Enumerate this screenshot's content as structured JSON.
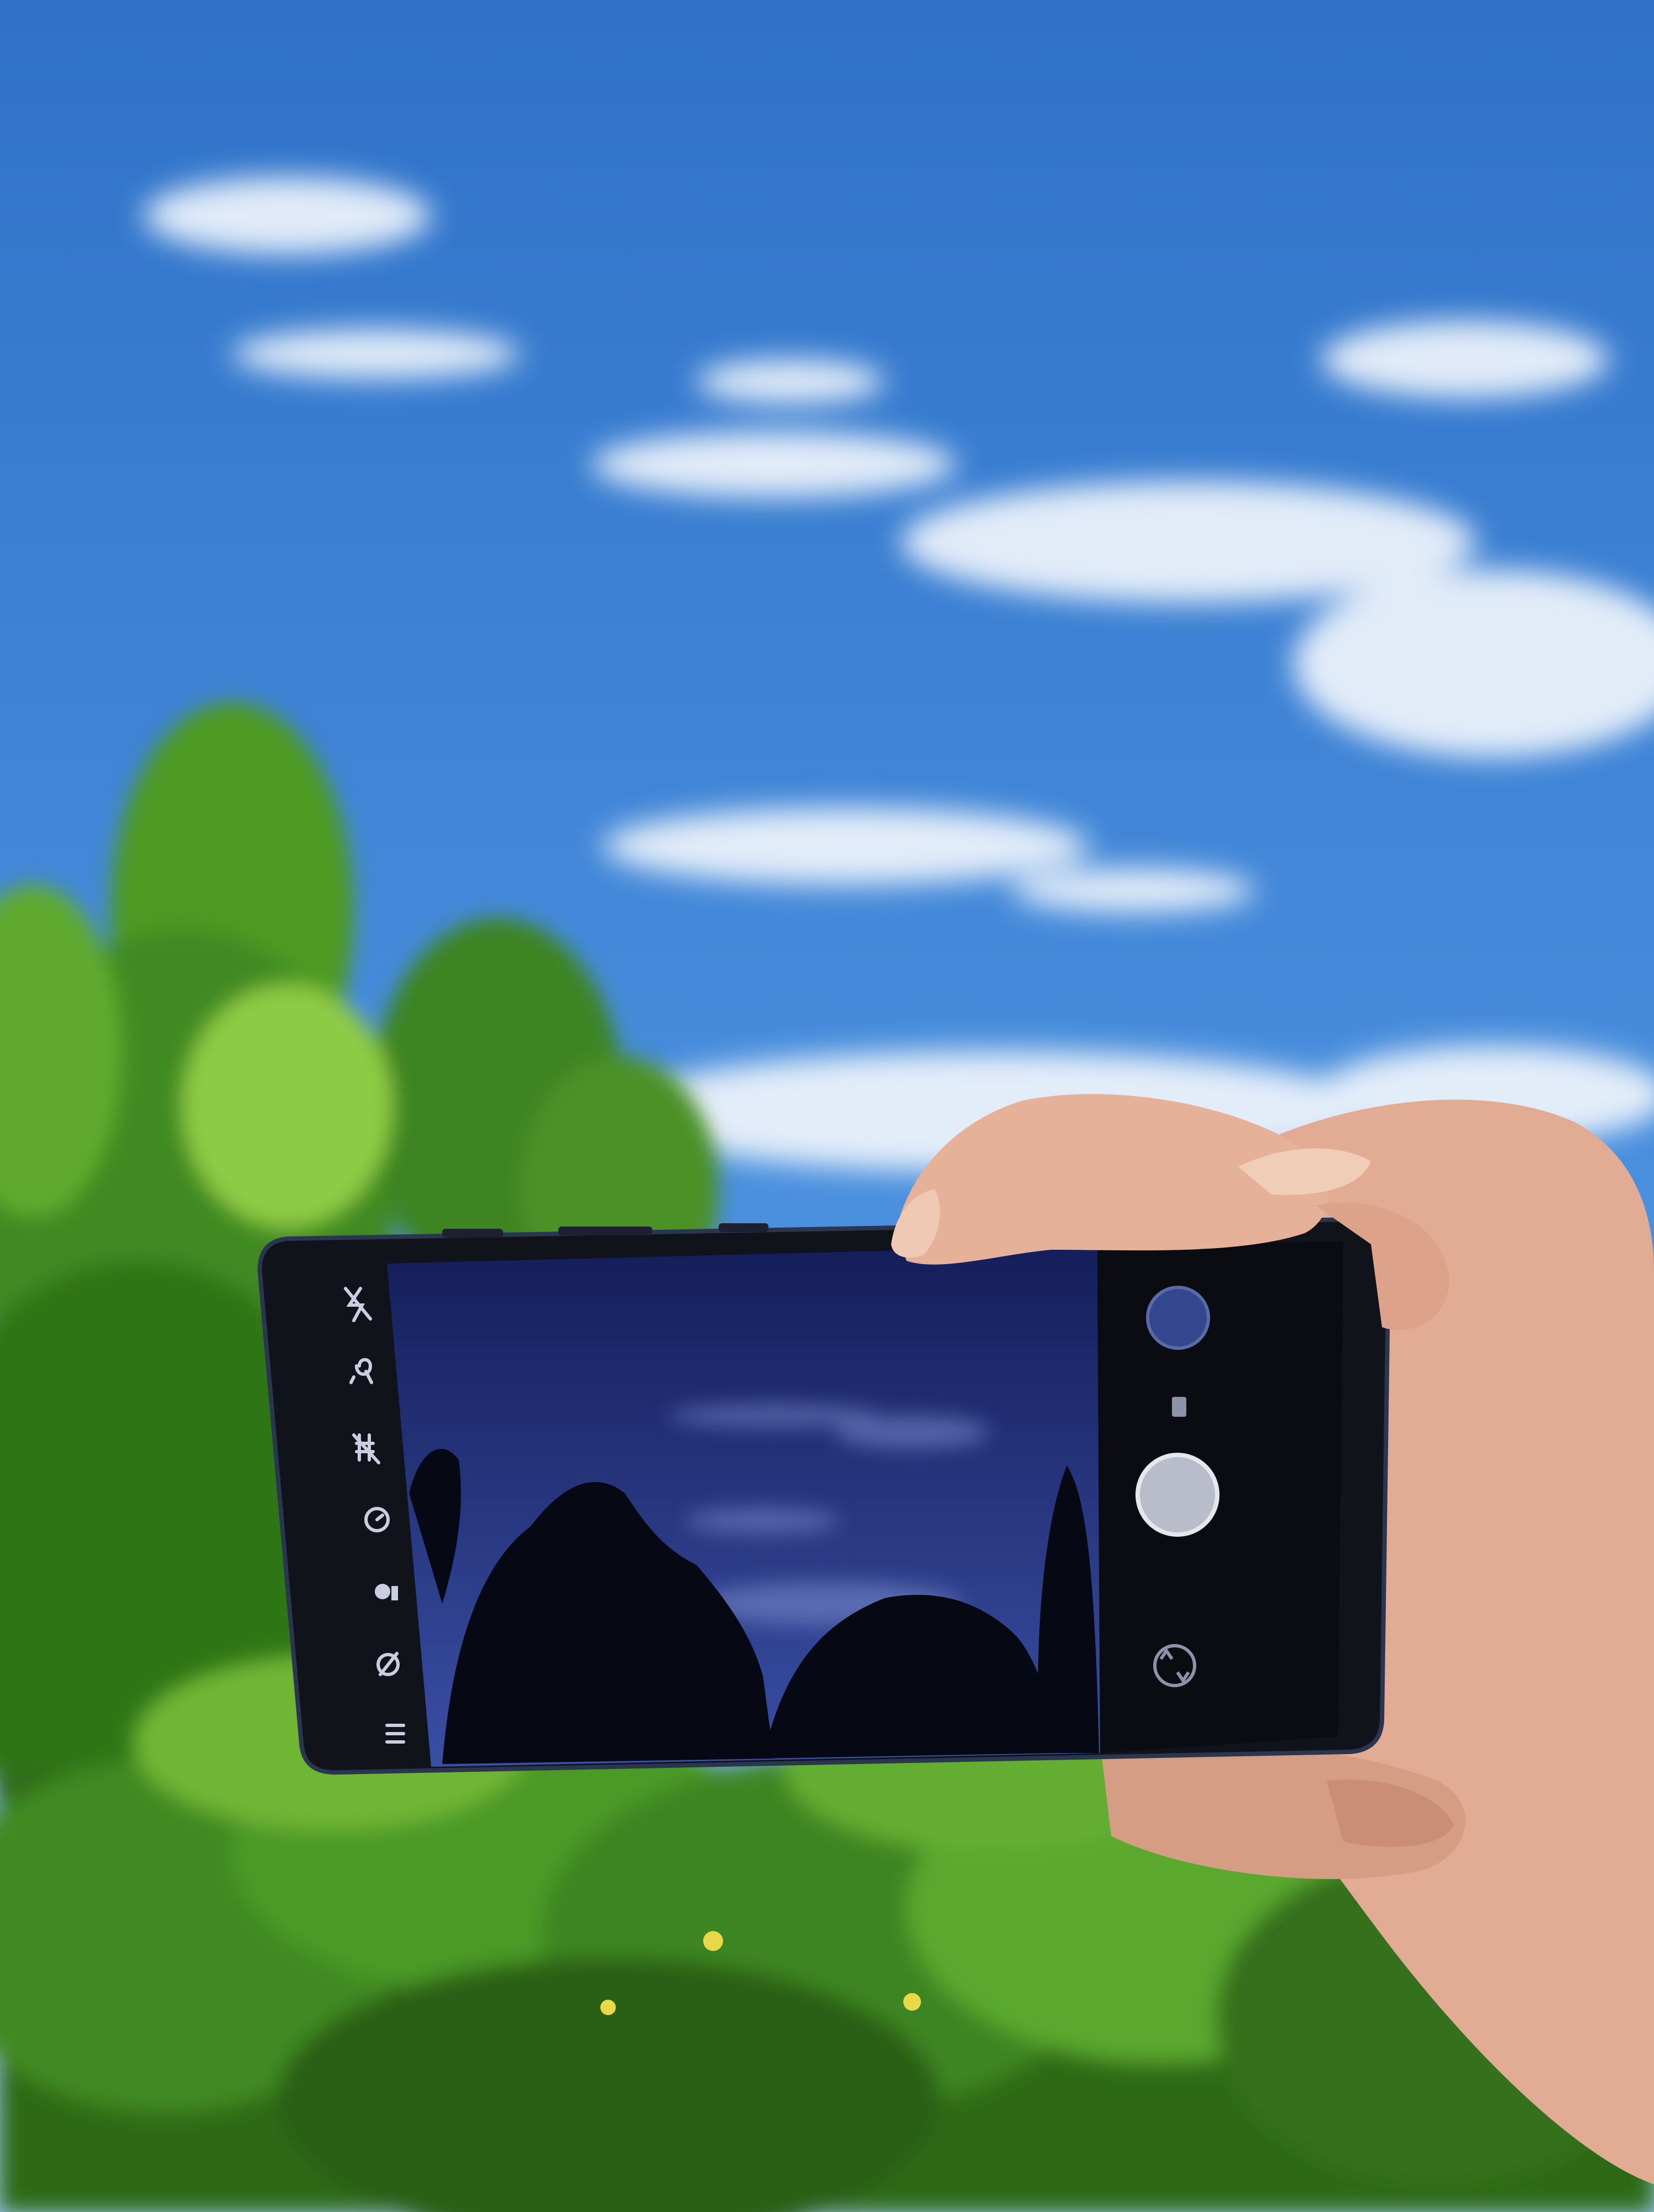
{
  "scene": {
    "sky_top": "#2f72c8",
    "sky_mid": "#4a90de",
    "sky_low": "#9cc4ec",
    "cloud": "#f4f8fd",
    "foliage_dark": "#1f4a14",
    "foliage_mid": "#3f8a22",
    "foliage_light": "#7cc23a",
    "trunk": "#4a4a32",
    "skin": "#e6b199",
    "skin_shadow": "#c98e74",
    "phone_body": "#101319",
    "phone_edge": "#2a3550"
  },
  "phone": {
    "screen_sky_top": "#141e5a",
    "screen_sky_bottom": "#3a4ea4",
    "screen_tree": "#060914"
  },
  "camera_app": {
    "left_toolbar": [
      {
        "name": "flash-off-icon"
      },
      {
        "name": "scene-mode-icon"
      },
      {
        "name": "hdr-off-icon"
      },
      {
        "name": "timer-icon"
      },
      {
        "name": "portrait-mode-icon"
      },
      {
        "name": "grid-off-icon"
      },
      {
        "name": "settings-menu-icon"
      }
    ],
    "right_controls": [
      {
        "name": "gallery-thumbnail"
      },
      {
        "name": "mode-switch-icon"
      },
      {
        "name": "shutter-button"
      },
      {
        "name": "switch-camera-icon"
      }
    ]
  }
}
